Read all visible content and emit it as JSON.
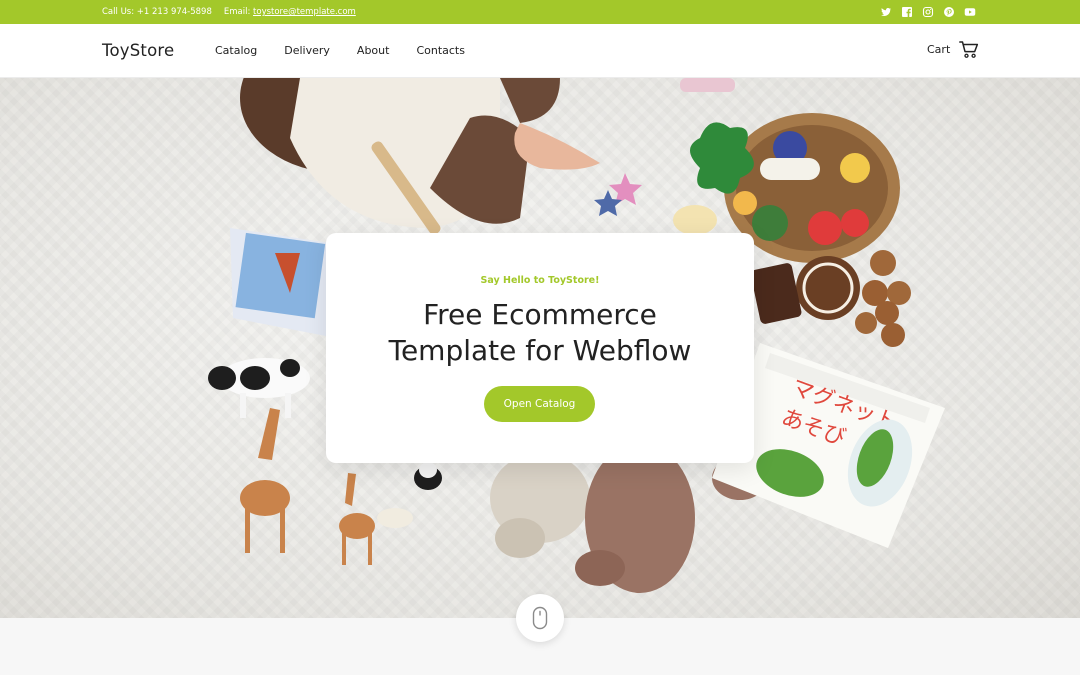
{
  "topbar": {
    "phone_text": "Call Us: +1 213 974-5898",
    "email_label": "Email: ",
    "email": "toystore@template.com",
    "social_icons": [
      "twitter-icon",
      "facebook-icon",
      "instagram-icon",
      "pinterest-icon",
      "youtube-icon"
    ],
    "background": "#a3c82a"
  },
  "nav": {
    "logo": "ToyStore",
    "items": [
      {
        "label": "Catalog"
      },
      {
        "label": "Delivery"
      },
      {
        "label": "About"
      },
      {
        "label": "Contacts"
      }
    ],
    "cart_label": "Cart",
    "cart_icon": "cart-icon"
  },
  "hero": {
    "kicker": "Say Hello to ToyStore!",
    "headline_line1": "Free Ecommerce",
    "headline_line2": "Template for Webflow",
    "button_label": "Open Catalog",
    "accent": "#a3c82a",
    "scroll_icon": "mouse-icon"
  }
}
